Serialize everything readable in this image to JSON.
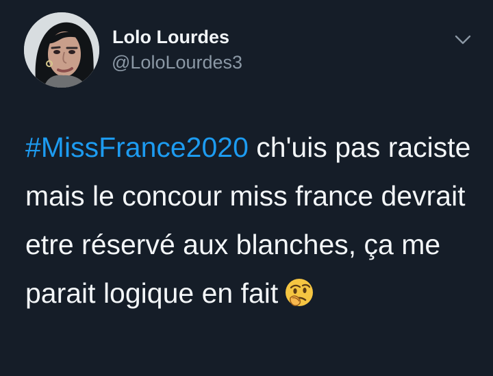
{
  "tweet": {
    "display_name": "Lolo Lourdes",
    "handle": "@LoloLourdes3",
    "hashtag": "#MissFrance2020",
    "text_after_hashtag": " ch'uis pas raciste mais le concour miss france devrait etre réservé aux blanches, ça me parait logique en fait",
    "emoji": "thinking-face-icon"
  },
  "colors": {
    "background": "#151d28",
    "text": "#f3f6f8",
    "secondary_text": "#8b98a5",
    "link": "#1d9bf0"
  },
  "icons": {
    "options_menu": "chevron-down-icon"
  }
}
